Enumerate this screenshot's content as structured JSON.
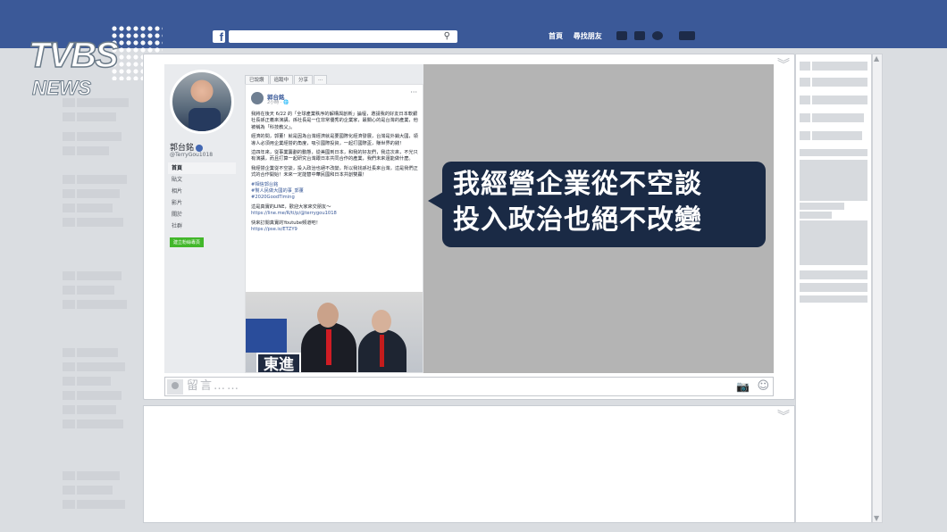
{
  "topbar": {
    "logo": "f",
    "nav": [
      "首頁",
      "尋找朋友"
    ],
    "icons": [
      "friends-icon",
      "messages-icon",
      "globe-icon",
      "settings-icon"
    ]
  },
  "watermark": {
    "line1": "TVBS",
    "line2": "NEWS"
  },
  "profile": {
    "name": "郭台銘",
    "handle": "@TerryGou1018",
    "menu": [
      "首頁",
      "貼文",
      "相片",
      "影片",
      "關於",
      "社群"
    ],
    "create_button": "建立粉絲專頁"
  },
  "actions": [
    "已說讚",
    "追蹤中",
    "分享",
    "···"
  ],
  "post": {
    "author": "郭台銘",
    "time": "2小時 · 🌐",
    "paragraphs": [
      "我將在後天 6/22 的「全球產業秩序的解構與創新」論壇，邀請我的好友日本軟銀社長孫正義來演講，孫社長是一位非常優秀的企業家，最關心的是台灣的產業，他被稱為「科技教父」。",
      "經濟的問，郭董！就是因為台灣經濟就是要國際化經濟發展，台灣是外銷大國，領導人必須用企業經營的角度，吸引國際投資，一起打國際盃，賺世界的錢！",
      "這四年來，從事業籌劃的動態，從美國到日本，和我的好友們，我這次來，不光只有演講，而且打算一起研究台灣跟日本共同合作的產業，我們未來還能做什麼。",
      "我經營企業從不空談，投入政治也絕不改變，所以我找孫社長來台灣，這是我們正式的合作開始！未來一定能替中華民國和日本共創雙贏！"
    ],
    "hashtags": [
      "#相信郭台銘",
      "#幫人民做大國的事_郭董",
      "#2020GoodTiming"
    ],
    "line_text": "這是真實的LINE，歡迎大家來交朋友～",
    "line_link": "https://line.me/R/ti/p/@terrygou1018",
    "yt_text": "快來訂閱真實的Youtube頻道吧！",
    "yt_link": "https://pse.is/ETZY9",
    "image_caption": "東進"
  },
  "bubble": {
    "line1": "我經營企業從不空談",
    "line2": "投入政治也絕不改變"
  },
  "comment": {
    "placeholder": "留言……"
  },
  "colors": {
    "facebook_blue": "#3b5998",
    "bubble_bg": "#1a2a45"
  }
}
